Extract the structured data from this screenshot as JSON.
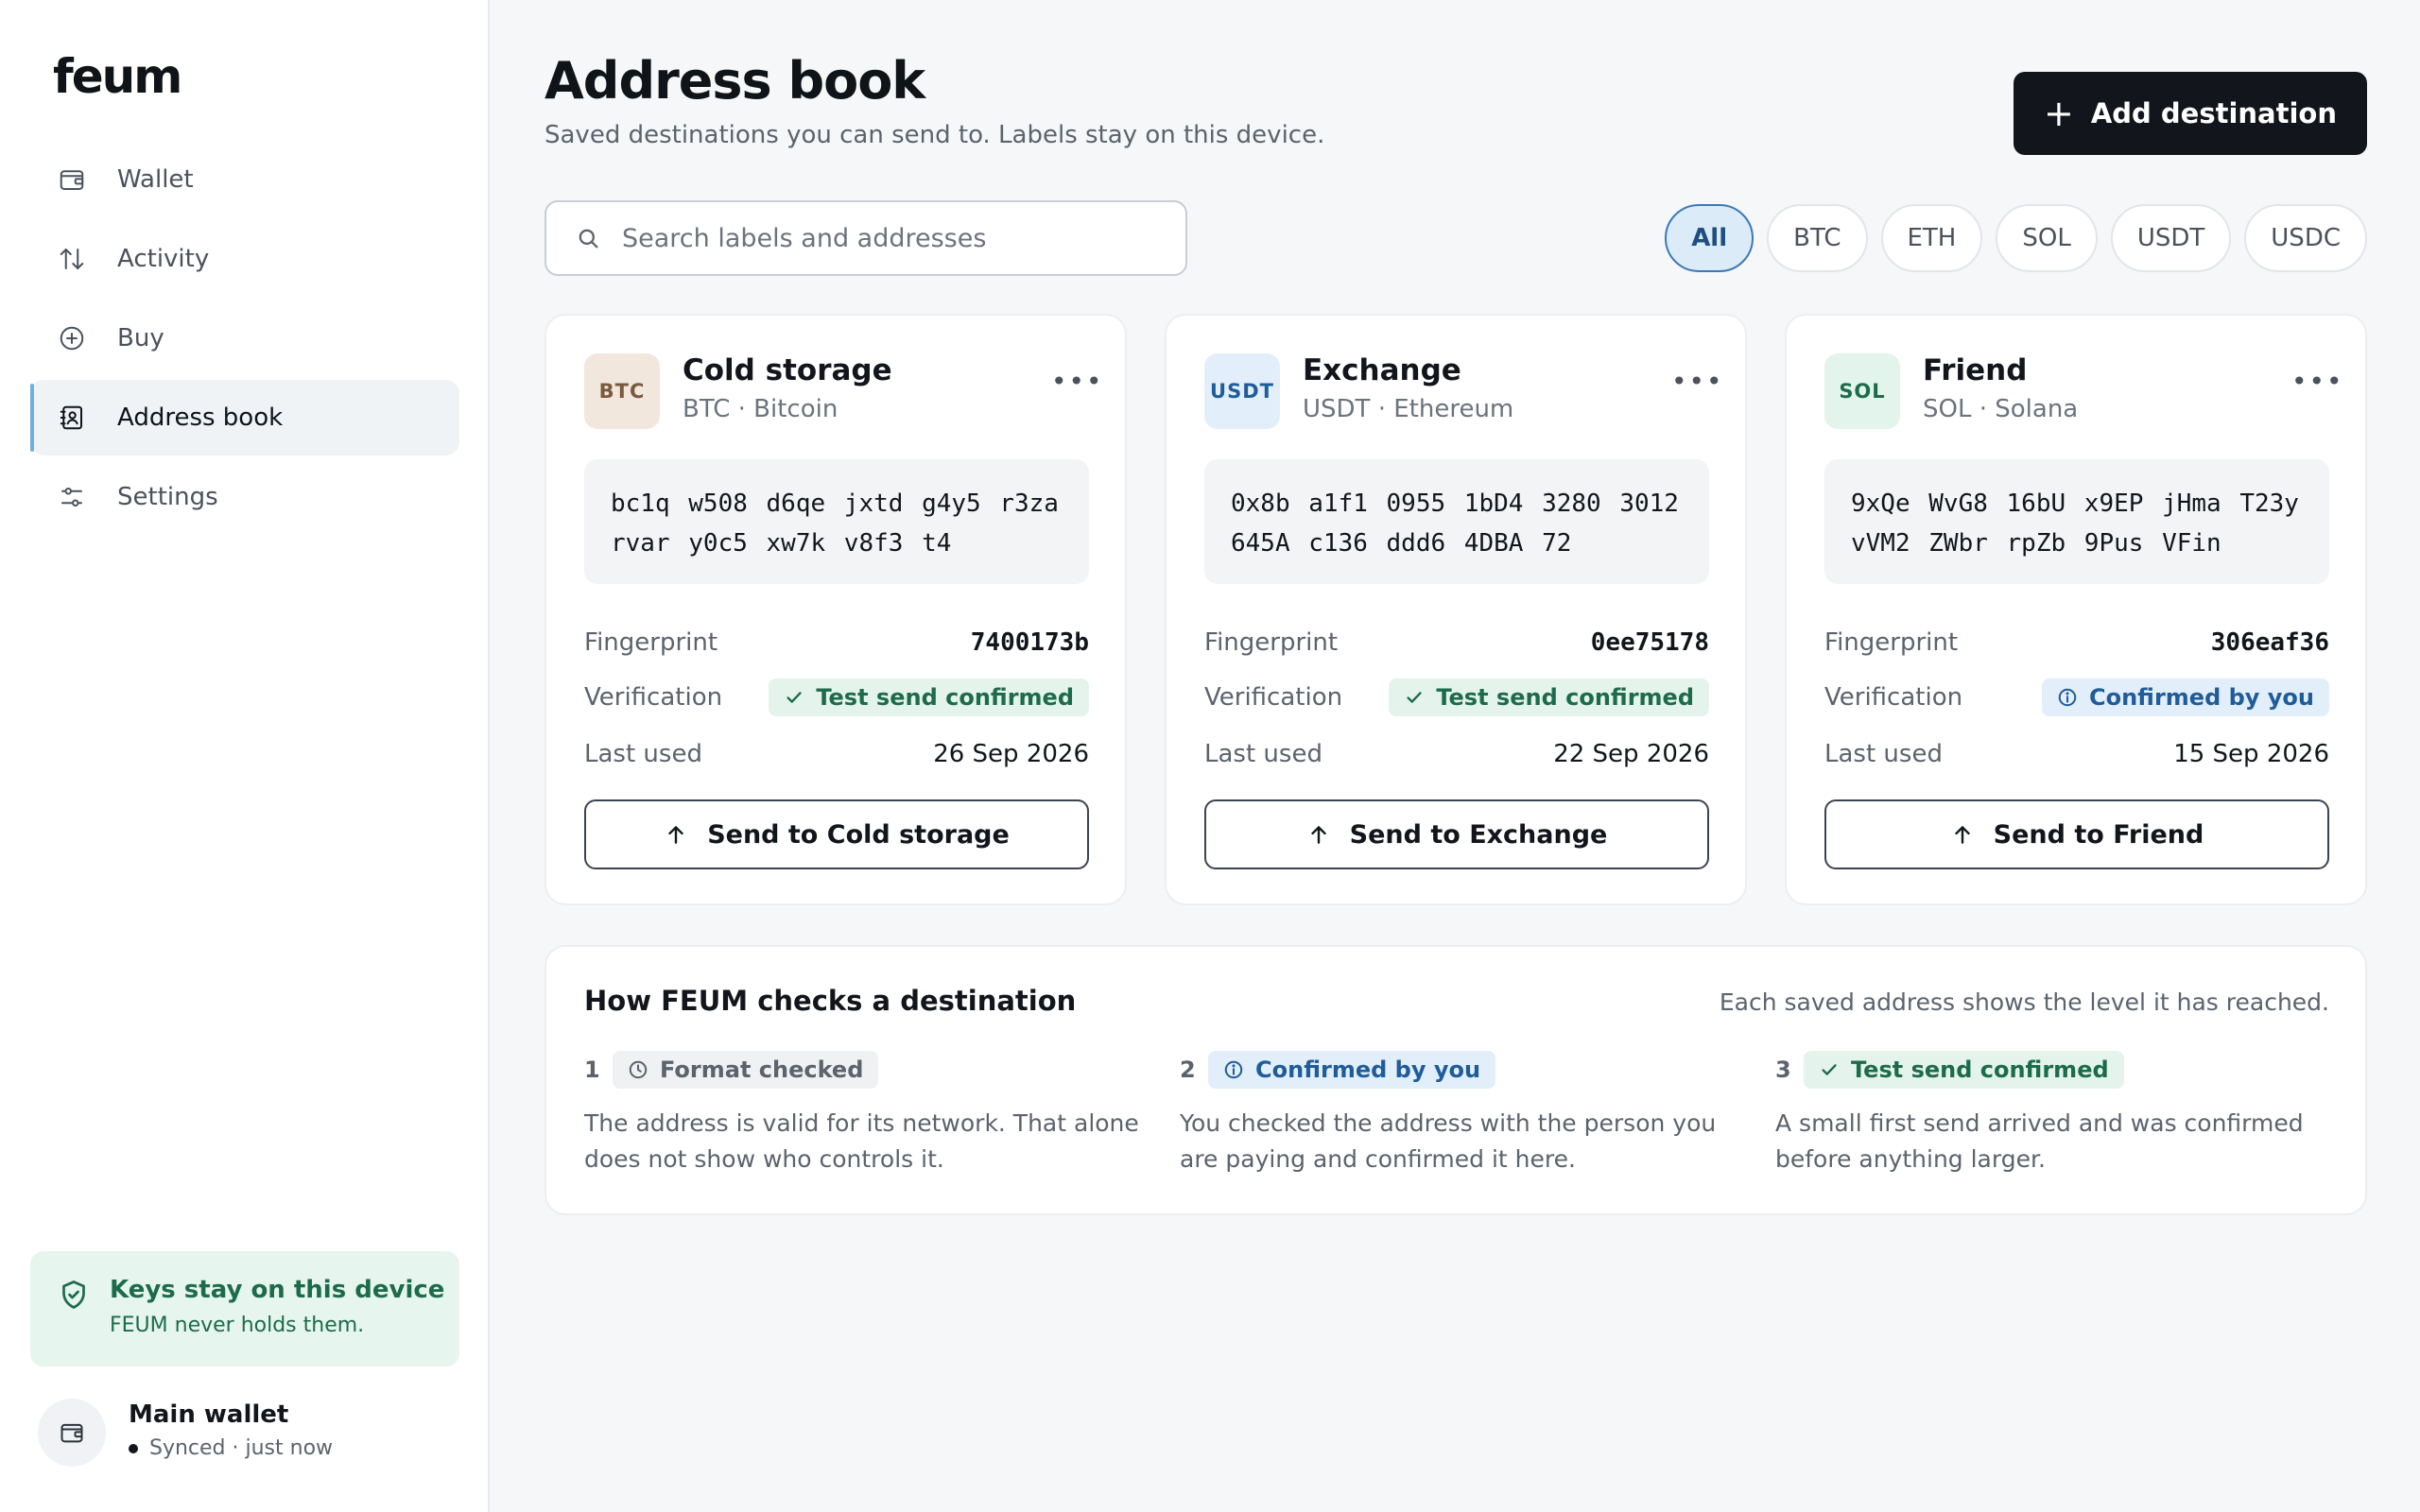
{
  "sidebar": {
    "logo": "feum",
    "nav": [
      {
        "label": "Wallet",
        "icon": "wallet-icon"
      },
      {
        "label": "Activity",
        "icon": "arrows-updown-icon"
      },
      {
        "label": "Buy",
        "icon": "plus-circle-icon"
      },
      {
        "label": "Address book",
        "icon": "contact-book-icon",
        "active": true
      },
      {
        "label": "Settings",
        "icon": "sliders-icon"
      }
    ],
    "keys": {
      "title": "Keys stay on this device",
      "subtitle": "FEUM never holds them.",
      "icon": "shield-check-icon"
    },
    "wallet": {
      "name": "Main wallet",
      "status": "Synced · just now",
      "icon": "wallet-icon"
    }
  },
  "header": {
    "title": "Address book",
    "subtitle": "Saved destinations you can send to. Labels stay on this device.",
    "add_button": "Add destination"
  },
  "search": {
    "placeholder": "Search labels and addresses",
    "value": ""
  },
  "filters": [
    "All",
    "BTC",
    "ETH",
    "SOL",
    "USDT",
    "USDC"
  ],
  "active_filter": "All",
  "labels": {
    "fingerprint": "Fingerprint",
    "verification": "Verification",
    "last_used": "Last used"
  },
  "cards": [
    {
      "badge": "BTC",
      "name": "Cold storage",
      "network": "BTC · Bitcoin",
      "address_line1": "bc1q w508 d6qe jxtd g4y5 r3za",
      "address_line2": "rvar y0c5 xw7k v8f3 t4",
      "fingerprint": "7400173b",
      "verification": "Test send confirmed",
      "verification_level": "green",
      "last_used": "26 Sep 2026",
      "send_label": "Send to Cold storage",
      "badge_bg": "#f2e7dd",
      "badge_fg": "#7a5a3d"
    },
    {
      "badge": "USDT",
      "name": "Exchange",
      "network": "USDT · Ethereum",
      "address_line1": "0x8b a1f1 0955 1bD4 3280 3012",
      "address_line2": "645A c136 ddd6 4DBA 72",
      "fingerprint": "0ee75178",
      "verification": "Test send confirmed",
      "verification_level": "green",
      "last_used": "22 Sep 2026",
      "send_label": "Send to Exchange",
      "badge_bg": "#e3eefb",
      "badge_fg": "#1f5d9a"
    },
    {
      "badge": "SOL",
      "name": "Friend",
      "network": "SOL · Solana",
      "address_line1": "9xQe WvG8 16bU x9EP jHma T23y",
      "address_line2": "vVM2 ZWbr rpZb 9Pus VFin",
      "fingerprint": "306eaf36",
      "verification": "Confirmed by you",
      "verification_level": "blue",
      "last_used": "15 Sep 2026",
      "send_label": "Send to Friend",
      "badge_bg": "#e3f4ec",
      "badge_fg": "#1d6b4d"
    }
  ],
  "how": {
    "title": "How FEUM checks a destination",
    "note": "Each saved address shows the level it has reached.",
    "steps": [
      {
        "num": "1",
        "label": "Format checked",
        "level": "grey",
        "icon": "clock-icon",
        "text": "The address is valid for its network. That alone does not show who controls it."
      },
      {
        "num": "2",
        "label": "Confirmed by you",
        "level": "blue",
        "icon": "info-icon",
        "text": "You checked the address with the person you are paying and confirmed it here."
      },
      {
        "num": "3",
        "label": "Test send confirmed",
        "level": "green",
        "icon": "check-icon",
        "text": "A small first send arrived and was confirmed before anything larger."
      }
    ]
  },
  "colors": {
    "accent": "#12161c",
    "active_chip": "#dcebf8",
    "success": "#1d6b4d",
    "info": "#1f5d9a"
  }
}
